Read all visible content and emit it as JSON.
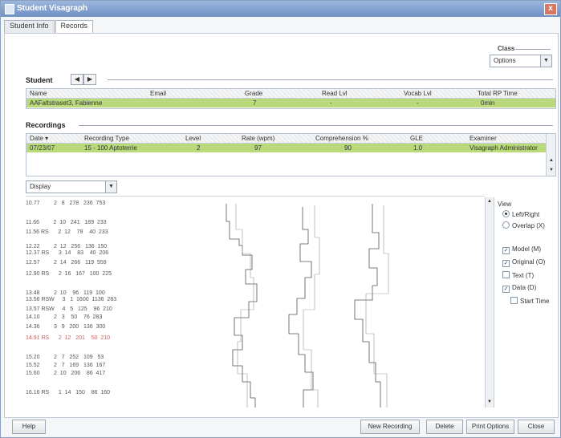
{
  "window": {
    "title": "Student Visagraph",
    "close_glyph": "x"
  },
  "tabs": [
    {
      "label": "Student Info"
    },
    {
      "label": "Records"
    }
  ],
  "class_box": {
    "label": "Class",
    "value": "Options"
  },
  "student": {
    "label": "Student",
    "prev": "◀",
    "next": "▶",
    "headers": [
      "Name",
      "Email",
      "Grade",
      "Read Lvl",
      "Vocab Lvl",
      "Total RP Time"
    ],
    "row": [
      "AAFaltstraset3, Fabienne",
      "",
      "7",
      "-",
      "-",
      "0min"
    ]
  },
  "recordings": {
    "label": "Recordings",
    "headers": [
      "Date ▾",
      "Recording Type",
      "Level",
      "Rate (wpm)",
      "Comprehension %",
      "GLE",
      "Examiner"
    ],
    "row": [
      "07/23/07",
      "15 - 100 Aptoterrie",
      "2",
      "97",
      "90",
      "1.0",
      "Visagraph Administrator"
    ]
  },
  "display_select": {
    "value": "Display"
  },
  "view": {
    "label": "View",
    "radios": [
      {
        "label": "Left/Right",
        "checked": true
      },
      {
        "label": "Overlap (X)",
        "checked": false
      }
    ],
    "checks": [
      {
        "label": "Model (M)",
        "checked": true
      },
      {
        "label": "Original (O)",
        "checked": true
      },
      {
        "label": "Text (T)",
        "checked": false
      },
      {
        "label": "Data (D)",
        "checked": true
      },
      {
        "label": "Start Time",
        "checked": false
      }
    ]
  },
  "data_lines": [
    {
      "t": "10.77         2   8   278   236  753",
      "red": false
    },
    {
      "t": "11.66         2  10   241   189  233",
      "red": false
    },
    {
      "t": "11.56 RS      2  12    78    40  233",
      "red": false
    },
    {
      "t": "12.22         2  12   256   136  150",
      "red": false
    },
    {
      "t": "12.37 RS      3  14    83    40  206",
      "red": false
    },
    {
      "t": "12.57         2  14   266   119  559",
      "red": false
    },
    {
      "t": "12.90 RS      2  16   167   100  225",
      "red": false
    },
    {
      "t": "13.48         2  10    96   119  100",
      "red": false
    },
    {
      "t": "13.56 RSW     3   1  1600  1136  283",
      "red": false
    },
    {
      "t": "13.57 RSW     4   5   125    96  210",
      "red": false
    },
    {
      "t": "14.10         2   3    50    76  283",
      "red": false
    },
    {
      "t": "14.36         3   9   200   136  300",
      "red": false
    },
    {
      "t": "14.91 RS      2  12   201    50  210",
      "red": true
    },
    {
      "t": "15.20         2   7   252   109   53",
      "red": false
    },
    {
      "t": "15.52         2   7   169   136  167",
      "red": false
    },
    {
      "t": "15.60         2  10   206    86  417",
      "red": false
    },
    {
      "t": "16.16 RS      1  14   150    86  160",
      "red": false
    }
  ],
  "buttons": {
    "help": "Help",
    "new_recording": "New Recording",
    "delete": "Delete",
    "print": "Print Options",
    "close": "Close"
  },
  "colors": {
    "selected_row": "#b9d97a",
    "title_bar": "#7d9ccc"
  }
}
